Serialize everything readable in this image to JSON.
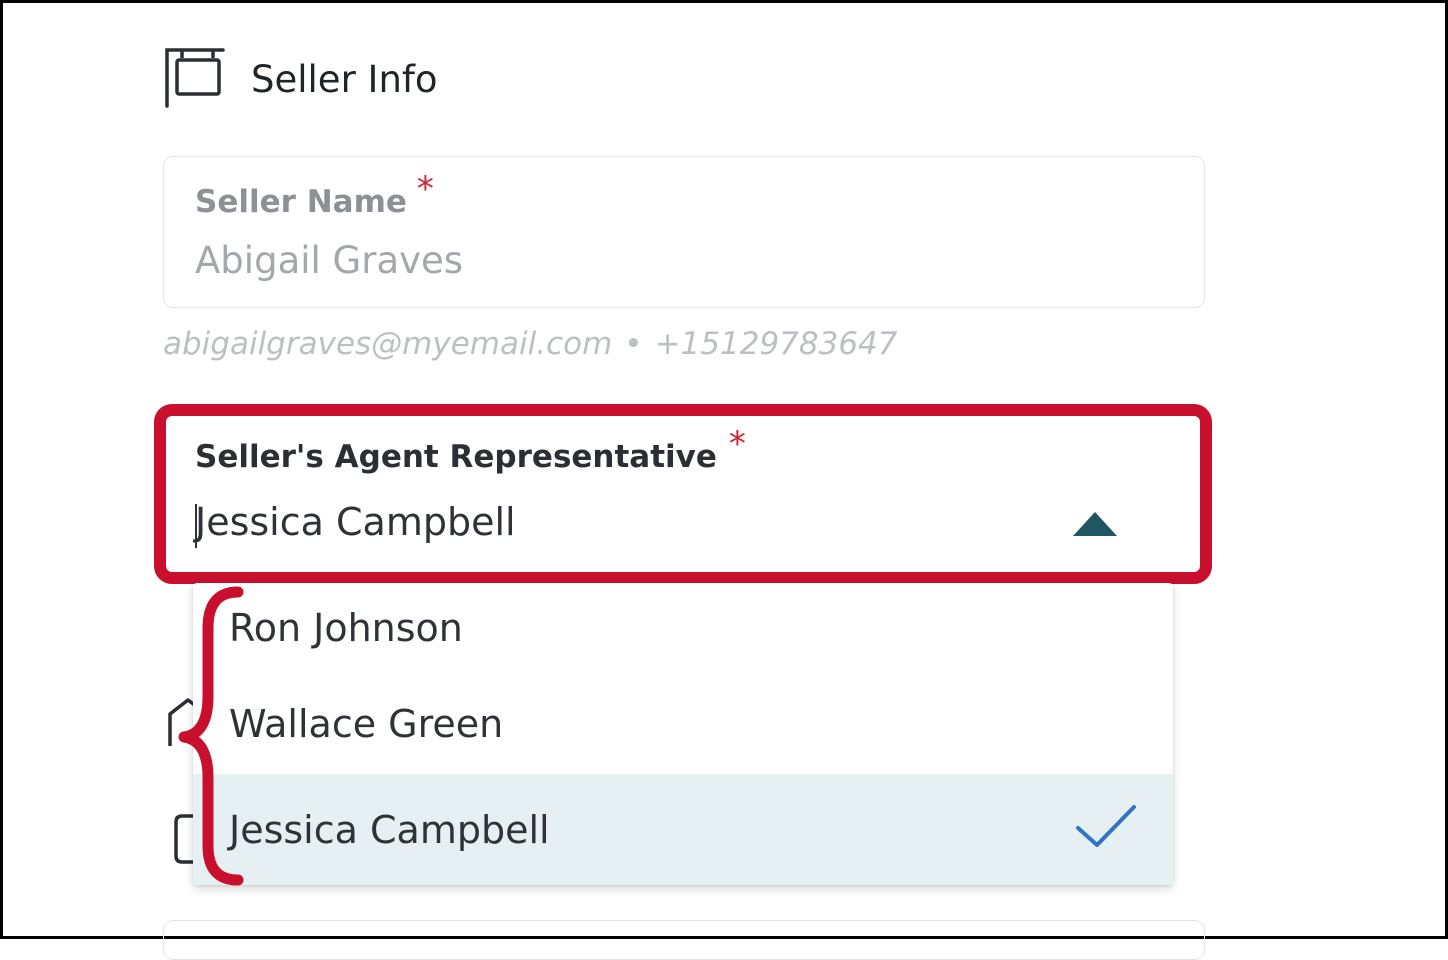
{
  "section": {
    "title": "Seller Info",
    "icon": "sign-icon"
  },
  "seller_name": {
    "label": "Seller Name",
    "required_mark": "*",
    "value": "Abigail Graves"
  },
  "contact": {
    "email": "abigailgraves@myemail.com",
    "separator": "•",
    "phone": "+15129783647"
  },
  "agent_select": {
    "label": "Seller's Agent Representative",
    "required_mark": "*",
    "value": "Jessica Campbell",
    "expanded": true,
    "options": [
      {
        "label": "Ron Johnson",
        "selected": false
      },
      {
        "label": "Wallace Green",
        "selected": false
      },
      {
        "label": "Jessica Campbell",
        "selected": true
      }
    ]
  },
  "colors": {
    "highlight_outline": "#c8102e",
    "required_star": "#cc2534",
    "arrow": "#1f5662",
    "selected_option_bg": "#e6f0f3",
    "check": "#2f73c4"
  }
}
